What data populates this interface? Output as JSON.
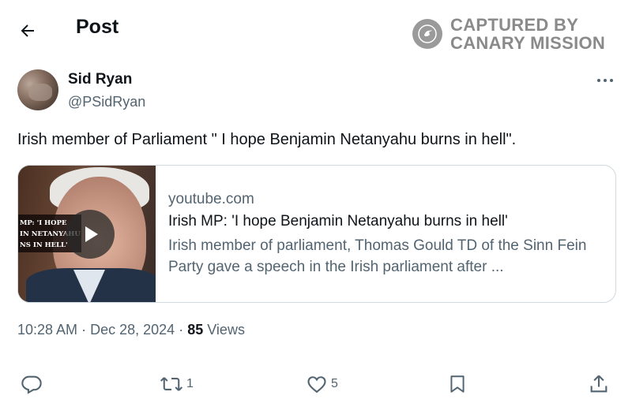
{
  "header": {
    "title": "Post",
    "back_icon": "arrow-left-icon"
  },
  "watermark": {
    "text": "CAPTURED BY\nCANARY MISSION",
    "logo_icon": "canary-bird-icon"
  },
  "post": {
    "author": {
      "display_name": "Sid Ryan",
      "handle": "@PSidRyan"
    },
    "more_icon": "more-horizontal-icon",
    "text": "Irish member of Parliament \" I hope Benjamin Netanyahu burns in hell\".",
    "link_card": {
      "domain": "youtube.com",
      "title": "Irish MP: 'I hope Benjamin Netanyahu burns in hell'",
      "description": "Irish member of parliament, Thomas Gould TD of the Sinn Fein Party gave a speech in the Irish parliament after ...",
      "thumbnail_caption": "MP: 'I HOPE\nIN NETANYAHU\nNS IN HELL'",
      "play_icon": "play-icon"
    },
    "meta": {
      "time": "10:28 AM",
      "separator": "·",
      "date": "Dec 28, 2024",
      "views_count": "85",
      "views_label": "Views"
    },
    "actions": {
      "reply_count": "",
      "repost_count": "1",
      "like_count": "5",
      "bookmark_count": "",
      "icons": [
        "reply-icon",
        "repost-icon",
        "like-icon",
        "bookmark-icon",
        "share-icon"
      ]
    }
  }
}
